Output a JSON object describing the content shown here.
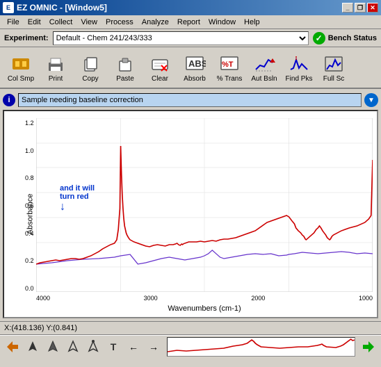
{
  "title_bar": {
    "app_name": "EZ OMNIC",
    "window_title": "EZ OMNIC - [Window5]",
    "controls": {
      "minimize": "_",
      "restore": "❐",
      "close": "✕"
    }
  },
  "menu_bar": {
    "items": [
      "File",
      "Edit",
      "Collect",
      "View",
      "Process",
      "Analyze",
      "Report",
      "Window",
      "Help"
    ]
  },
  "experiment_bar": {
    "label": "Experiment:",
    "value": "Default - Chem 241/243/333",
    "bench_status_label": "Bench Status"
  },
  "toolbar": {
    "buttons": [
      {
        "name": "col-smp",
        "label": "Col Smp"
      },
      {
        "name": "print",
        "label": "Print"
      },
      {
        "name": "copy",
        "label": "Copy"
      },
      {
        "name": "paste",
        "label": "Paste"
      },
      {
        "name": "clear",
        "label": "Clear"
      },
      {
        "name": "absorb",
        "label": "Absorb"
      },
      {
        "name": "pct-trans",
        "label": "% Trans"
      },
      {
        "name": "aut-bsln",
        "label": "Aut Bsln"
      },
      {
        "name": "find-pks",
        "label": "Find Pks"
      },
      {
        "name": "full-sc",
        "label": "Full Sc"
      }
    ]
  },
  "spectrum": {
    "title": "Sample needing baseline correction",
    "y_label": "Absorbance",
    "x_label": "Wavenumbers (cm-1)",
    "y_ticks": [
      "1.2",
      "1.0",
      "0.8",
      "0.6",
      "0.4",
      "0.2",
      "0.0"
    ],
    "x_ticks": [
      "4000",
      "3000",
      "2000",
      "1000"
    ],
    "annotation": "and it will\nturn red"
  },
  "status_bar": {
    "text": "X:(418.136) Y:(0.841)"
  },
  "bottom_toolbar": {
    "buttons": [
      "↩",
      "▲",
      "▲",
      "△",
      "△",
      "T",
      "←",
      "→",
      "⏩"
    ],
    "mini_chart_peaks": [
      0.3,
      0.2,
      0.25,
      0.8,
      0.9,
      0.2,
      0.15,
      0.2,
      0.3,
      0.25,
      0.4,
      0.9
    ]
  }
}
